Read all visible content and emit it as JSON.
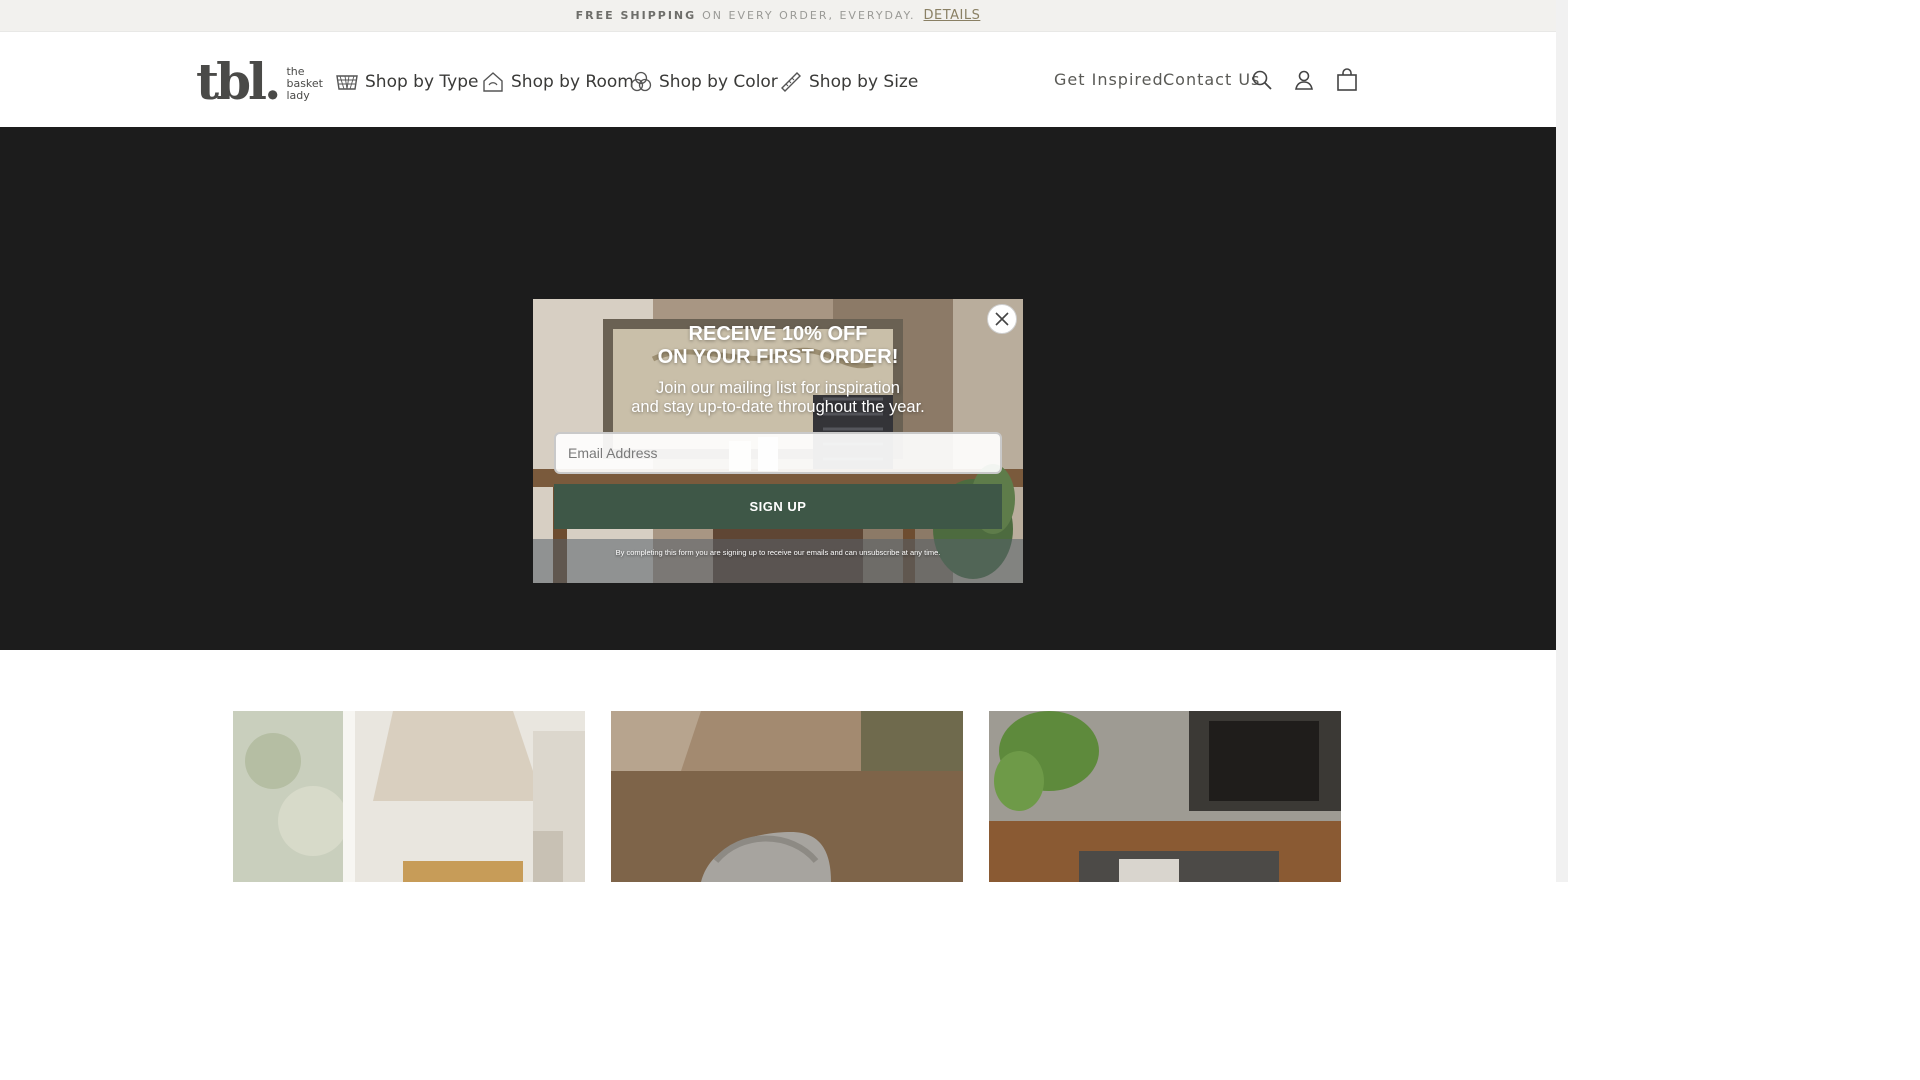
{
  "announcement": {
    "bold_text": "FREE SHIPPING",
    "rest_text": "ON EVERY ORDER, EVERYDAY.",
    "link_text": "DETAILS"
  },
  "header": {
    "logo": {
      "mark": "tbl.",
      "line1": "the",
      "line2": "basket",
      "line3": "lady"
    },
    "nav": [
      {
        "label": "Shop by Type",
        "icon": "basket-icon"
      },
      {
        "label": "Shop by Room",
        "icon": "house-icon"
      },
      {
        "label": "Shop by Color",
        "icon": "color-circles-icon"
      },
      {
        "label": "Shop by Size",
        "icon": "ruler-icon"
      }
    ],
    "links": [
      {
        "label": "Get Inspired"
      },
      {
        "label": "Contact Us"
      }
    ],
    "icons": [
      "search-icon",
      "account-icon",
      "cart-bag-icon"
    ]
  },
  "popup": {
    "title_line1": "RECEIVE 10% OFF",
    "title_line2": "ON YOUR FIRST ORDER!",
    "subtitle_line1": "Join our mailing list for inspiration",
    "subtitle_line2": "and stay up-to-date throughout the year.",
    "email_placeholder": "Email Address",
    "button_label": "SIGN UP",
    "fine_print": "By completing this form you are signing up to receive our emails and can unsubscribe at any time.",
    "close_icon": "close-x-icon"
  },
  "colors": {
    "accent_green": "#3e5747",
    "hero_bg": "#1c1c1c",
    "announce_bg": "#f2f1ee",
    "link_gold": "#8a8064"
  }
}
